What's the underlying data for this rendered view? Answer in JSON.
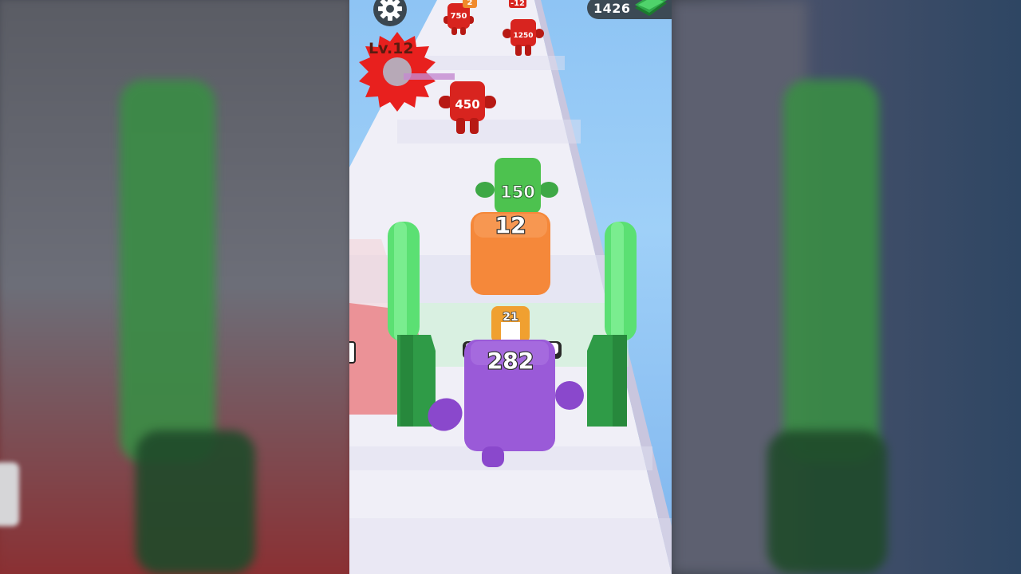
{
  "hud": {
    "level_label": "Lv.12",
    "money": "1426",
    "settings_icon": "gear-icon",
    "money_icon": "cash-stack-icon"
  },
  "enemies": [
    {
      "value": "750",
      "color": "#d8241f"
    },
    {
      "value": "2",
      "color": "#f08a2c"
    },
    {
      "value": "-12",
      "color": "#d8241f"
    },
    {
      "value": "1250",
      "color": "#d8241f"
    },
    {
      "value": "450",
      "color": "#d8241f"
    }
  ],
  "ally_green": {
    "value": "150",
    "color": "#4dc24f"
  },
  "orange_block": {
    "value": "12",
    "color": "#f5883a"
  },
  "small_block": {
    "value": "21",
    "color": "#f0a030"
  },
  "player": {
    "value": "282",
    "color": "#9a5ad8"
  },
  "colors": {
    "road": "#ecebf5",
    "sky": "#8ec4f4",
    "gate": "#46c85c",
    "saw": "#e8201e"
  }
}
